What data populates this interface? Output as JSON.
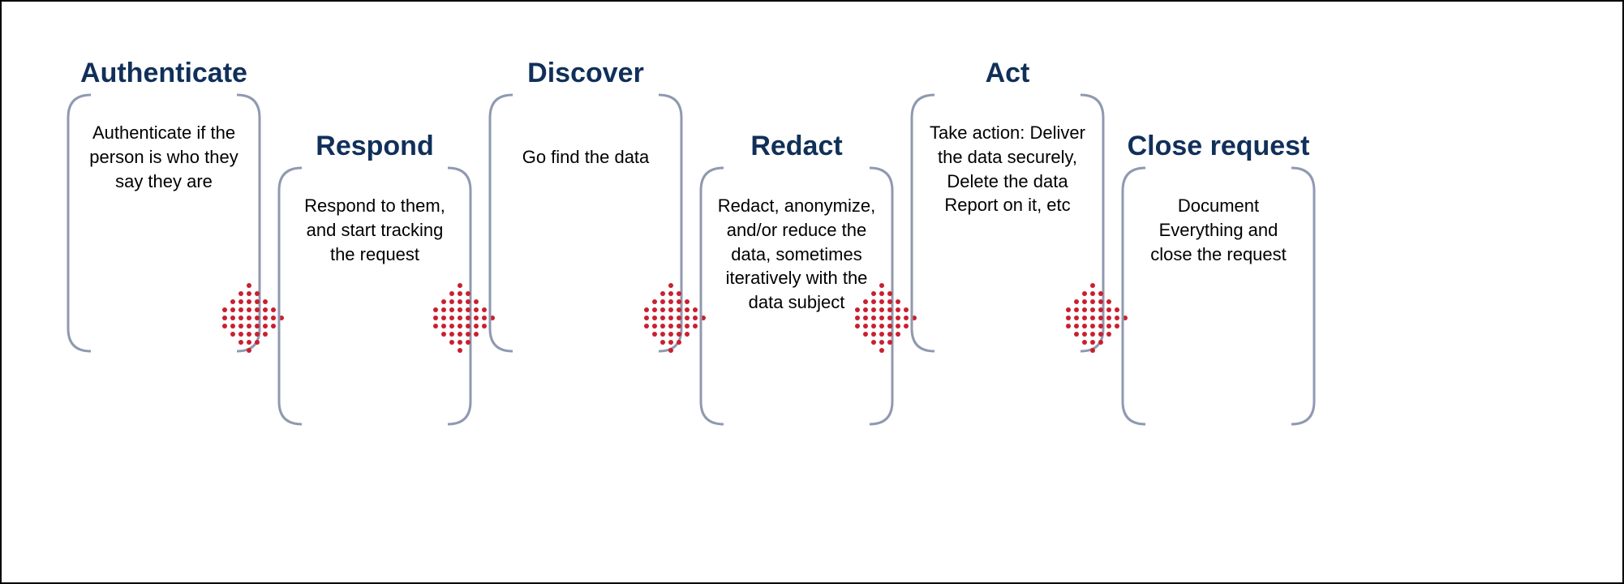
{
  "colors": {
    "title": "#10305a",
    "frame_stroke": "#8f99b0",
    "arrow_dot": "#c8202f",
    "border": "#000000"
  },
  "steps": [
    {
      "title": "Authenticate",
      "desc": "Authenticate if the person is who they say they are"
    },
    {
      "title": "Respond",
      "desc": "Respond to them, and start tracking the request"
    },
    {
      "title": "Discover",
      "desc": "Go find the data"
    },
    {
      "title": "Redact",
      "desc": "Redact, anonymize, and/or reduce the data, sometimes iteratively with the data subject"
    },
    {
      "title": "Act",
      "desc": "Take action: Deliver the data securely, Delete the data Report on it, etc"
    },
    {
      "title": "Close request",
      "desc": "Document Everything and close the request"
    }
  ]
}
